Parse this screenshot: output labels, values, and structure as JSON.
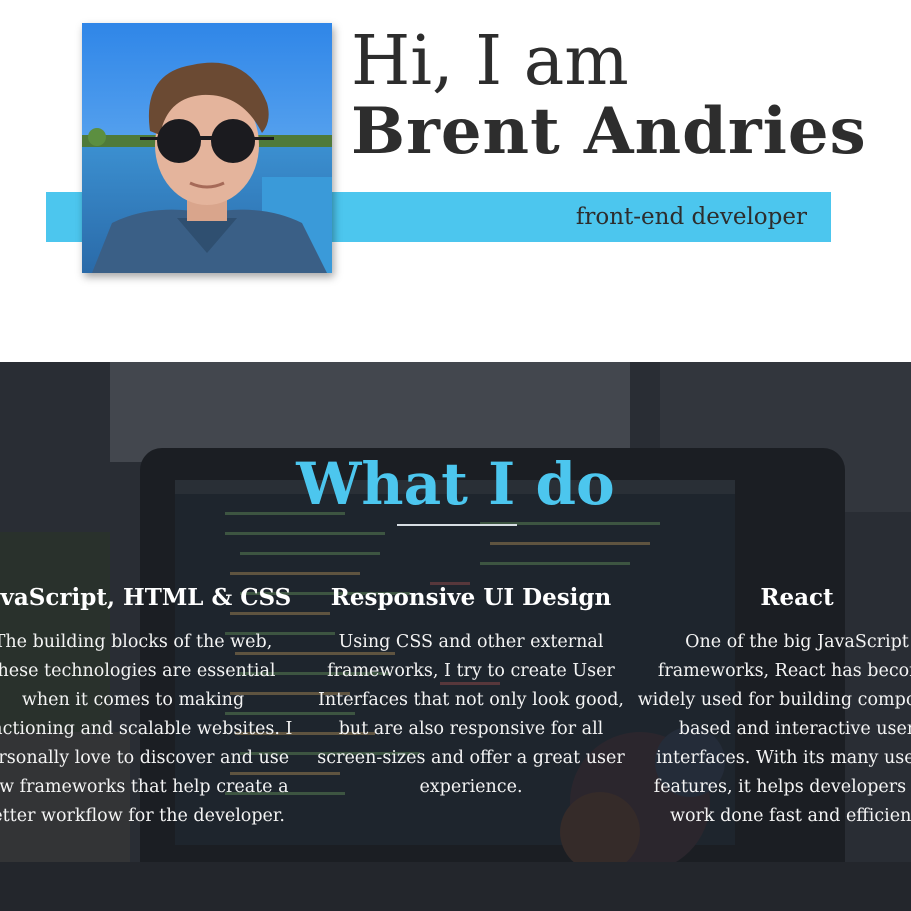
{
  "hero": {
    "greeting": "Hi, I am",
    "name": "Brent Andries",
    "role": "front-end developer"
  },
  "whatido": {
    "title": "What I do",
    "items": [
      {
        "title": "JavaScript, HTML & CSS",
        "text": "The building blocks of the web, these technologies are essential when it comes to making functioning and scalable websites. I personally love to discover and use new frameworks that help create a better workflow for the developer."
      },
      {
        "title": "Responsive UI Design",
        "text": "Using CSS and other external frameworks, I try to create User Interfaces that not only look good, but are also responsive for all screen-sizes and offer a great user experience."
      },
      {
        "title": "React",
        "text": "One of the big JavaScript frameworks, React has become widely used for building component based and interactive user interfaces. With its many useful features, it helps developers get work done fast and efficient."
      }
    ]
  },
  "colors": {
    "accent": "#4cc6ee",
    "text_dark": "#2d2d2d"
  }
}
